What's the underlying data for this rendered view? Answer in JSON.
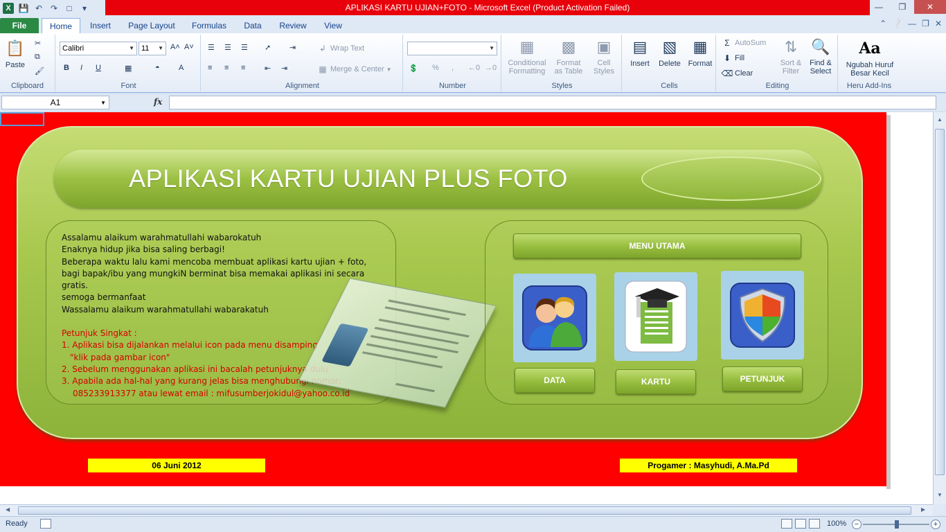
{
  "window": {
    "title": "APLIKASI KARTU UJIAN+FOTO  -  Microsoft Excel (Product Activation Failed)"
  },
  "tabs": [
    "File",
    "Home",
    "Insert",
    "Page Layout",
    "Formulas",
    "Data",
    "Review",
    "View"
  ],
  "ribbon": {
    "clipboard": {
      "label": "Clipboard",
      "paste": "Paste"
    },
    "font": {
      "label": "Font",
      "name": "Calibri",
      "size": "11",
      "bold": "B",
      "italic": "I",
      "underline": "U"
    },
    "alignment": {
      "label": "Alignment",
      "wrap_text": "Wrap Text",
      "merge_center": "Merge & Center"
    },
    "number": {
      "label": "Number",
      "format": "",
      "percent": "%",
      "comma": ","
    },
    "styles": {
      "label": "Styles",
      "conditional": "Conditional\nFormatting",
      "format_table": "Format\nas Table",
      "cell_styles": "Cell\nStyles"
    },
    "cells": {
      "label": "Cells",
      "insert": "Insert",
      "delete": "Delete",
      "format": "Format"
    },
    "editing": {
      "label": "Editing",
      "autosum": "AutoSum",
      "fill": "Fill",
      "clear": "Clear",
      "sort_filter": "Sort &\nFilter",
      "find_select": "Find &\nSelect"
    },
    "addins": {
      "label": "Heru Add-Ins",
      "button": "Ngubah Huruf\nBesar Kecil",
      "icon_text": "Aa"
    }
  },
  "formula_bar": {
    "name_box": "A1",
    "fx": "fx",
    "value": ""
  },
  "sheet": {
    "banner_title": "APLIKASI KARTU UJIAN PLUS FOTO",
    "intro_lines": [
      "Assalamu alaikum warahmatullahi wabarokatuh",
      "Enaknya hidup jika bisa saling berbagi!",
      "Beberapa waktu lalu kami mencoba membuat aplikasi kartu ujian + foto,",
      "bagi bapak/ibu  yang mungkiN berminat bisa memakai aplikasi  ini secara gratis.",
      "semoga bermanfaat",
      "Wassalamu alaikum warahmatullahi wabarakatuh"
    ],
    "petunjuk_title": "Petunjuk Singkat :",
    "petunjuk_lines": [
      "1. Aplikasi bisa dijalankan melalui  icon pada menu disamping",
      "\"klik pada gambar icon\"",
      "2. Sebelum menggunakan aplikasi ini bacalah petunjuknya dulu",
      "3. Apabila ada hal-hal yang kurang jelas bisa menghubungi nomor:",
      "085233913377 atau lewat email : mifusumberjokidul@yahoo.co.id"
    ],
    "menu_title": "MENU UTAMA",
    "menu_buttons": [
      "DATA",
      "KARTU",
      "PETUNJUK"
    ],
    "tile_icons": [
      "users-icon",
      "document-graduation-icon",
      "shield-icon"
    ],
    "date": "06 Juni 2012",
    "author": "Progamer : Masyhudi, A.Ma.Pd"
  },
  "status": {
    "ready": "Ready",
    "zoom": "100%",
    "zoom_level": 1.0
  },
  "colors": {
    "sheet_bg": "#fe0000",
    "panel_green": "#a8c84e",
    "date_bar": "#ffff00",
    "title_strip": "#e8000b",
    "file_tab": "#2a8a44"
  }
}
